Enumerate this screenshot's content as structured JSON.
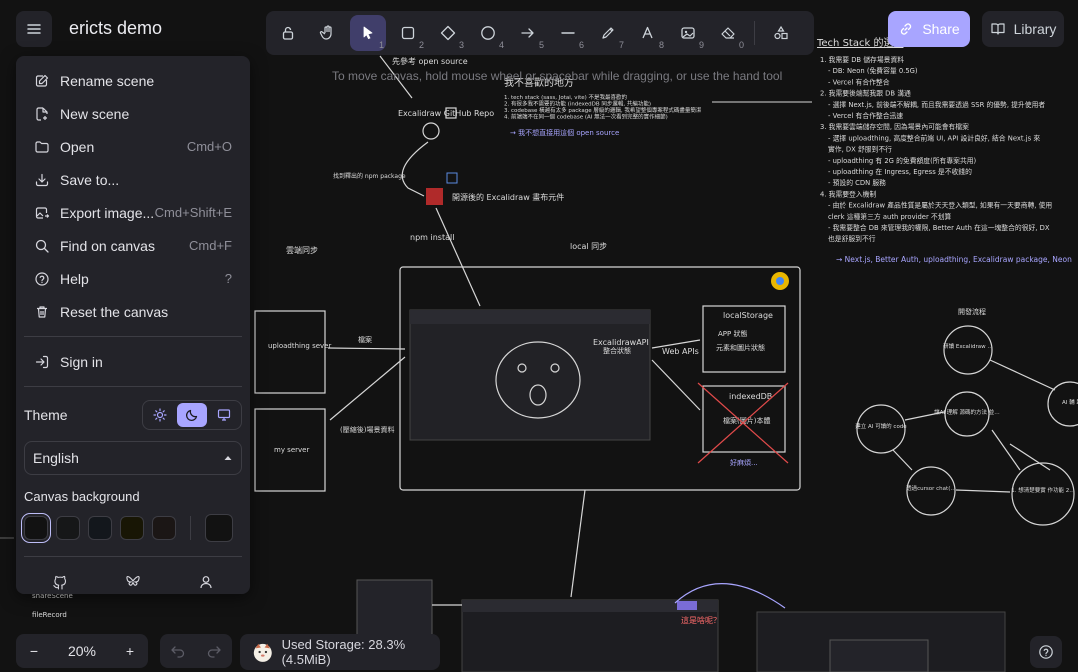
{
  "app": {
    "scene_name": "ericts demo",
    "hint": "To move canvas, hold mouse wheel or spacebar while dragging, or use the hand tool"
  },
  "toolbar": {
    "tools": [
      {
        "icon": "lock-icon",
        "key": ""
      },
      {
        "icon": "hand-icon",
        "key": ""
      },
      {
        "icon": "pointer-icon",
        "key": "1"
      },
      {
        "icon": "rectangle-icon",
        "key": "2"
      },
      {
        "icon": "diamond-icon",
        "key": "3"
      },
      {
        "icon": "ellipse-icon",
        "key": "4"
      },
      {
        "icon": "arrow-icon",
        "key": "5"
      },
      {
        "icon": "line-icon",
        "key": "6"
      },
      {
        "icon": "pencil-icon",
        "key": "7"
      },
      {
        "icon": "text-icon",
        "key": "8"
      },
      {
        "icon": "image-icon",
        "key": "9"
      },
      {
        "icon": "eraser-icon",
        "key": "0"
      },
      {
        "icon": "shapes-icon",
        "key": ""
      }
    ],
    "active_tool": "pointer-icon"
  },
  "share_label": "Share",
  "library_label": "Library",
  "menu": {
    "group1": [
      {
        "label": "Rename scene",
        "shortcut": ""
      },
      {
        "label": "New scene",
        "shortcut": ""
      },
      {
        "label": "Open",
        "shortcut": "Cmd+O"
      },
      {
        "label": "Save to...",
        "shortcut": ""
      },
      {
        "label": "Export image...",
        "shortcut": "Cmd+Shift+E"
      },
      {
        "label": "Find on canvas",
        "shortcut": "Cmd+F"
      },
      {
        "label": "Help",
        "shortcut": "?"
      },
      {
        "label": "Reset the canvas",
        "shortcut": ""
      }
    ],
    "sign_in": "Sign in",
    "theme_label": "Theme",
    "theme_selected": "dark",
    "language": "English",
    "canvas_bg_label": "Canvas background",
    "swatches": [
      "#121212",
      "#161718",
      "#13171c",
      "#181605",
      "#1b1615"
    ],
    "custom_swatch": "#121212"
  },
  "zoom": {
    "minus": "−",
    "value": "20%",
    "plus": "+"
  },
  "storage": "Used Storage: 28.3% (4.5MiB)",
  "canvas": {
    "ref_open_source": "先參考 open source",
    "excalidraw_repo": "Excalidraw GitHub Repo",
    "find_npm": "找到釋出的 npm package",
    "npm_pkg": "開源後的 Excalidraw 畫布元件",
    "npm_install": "npm install",
    "local_sync": "local 同步",
    "cloud_sync": "雲端同步",
    "not_like_title": "我不喜歡的地方",
    "not_like_items": [
      "1. tech stack (sass, Jotai, vite) 不是我最喜歡的",
      "2. 有很多我不需要的功能 (indexedDB 同步邏輯, 共編功能)",
      "3. codebase 橫越有太多 package 層級的邏輯, 我希望整個專案程式碼盡量簡潔",
      "4. 前端端不在同一個 codebase (AI 無法一次看到完整的實作細節)"
    ],
    "not_use_os": "→ 我不想直接用這個 open source",
    "tech_stack_title": "Tech Stack 的選擇",
    "tech_stack_items": [
      "1. 我需要 DB 儲存場景資料",
      "- DB: Neon (免費容量 0.5G)",
      "- Vercel 有合作整合",
      "2. 我需要後端幫我跟 DB 溝通",
      "- 選擇 Next.js, 前後端不解耦, 而且我需要透過 SSR 的優勢, 提升使用者",
      "- Vercel 有合作整合迅速",
      "3. 我需要雲端儲存空間, 因為場景內可能會有檔案",
      "- 選擇 uploadthing, 高度整合前端 UI, API 設計良好, 結合 Next.js 來",
      "  實作, DX 舒服到不行",
      "- uploadthing 有 2G 的免費額度(所有專案共用)",
      "- uploadthing 在 Ingress, Egress 是不收錢的",
      "- 預設的 CDN 服務",
      "4. 我需要登入機制",
      "- 由於 Excalidraw 產品性質是屬於天天登入類型, 如果有一天要商轉, 使用",
      "  clerk 這種第三方 auth provider 不划算",
      "- 我需要整合 DB 來管理我的權限, Better Auth 在這一塊整合的很好, DX",
      "  也是舒服到不行"
    ],
    "tech_result": "→ Next.js, Better Auth, uploadthing, Excalidraw package, Neon",
    "upload_server": "uploadthing sever",
    "file_label": "檔案",
    "my_server": "my server",
    "compressed": "(壓縮後)場景資料",
    "excal_api": "ExcalidrawAPI",
    "excal_state": "整合狀態",
    "web_apis": "Web APIs",
    "local_storage": "localStorage",
    "app_state": "APP 狀態",
    "element_state": "元素和圖片狀態",
    "indexed_db": "indexedDB",
    "file_storage": "檔案(圖片)本體",
    "slow": "好麻煩...",
    "dev_flow": "開發流程",
    "flow_nodes": [
      "研讀 Excalidraw open source codebase",
      "建立 AI 可讀的 code",
      "讓AI 理解 源碼的方法 並設計與重 構",
      "透過cursor chat(GPT-5) 實現功能 在我自己的 codebase",
      "1. 想清楚要實 作功能 2. 參照open source Preset 範例"
    ],
    "node_ai": "AI 輔 助",
    "share_scene": "shareScene",
    "file_record": "fileRecord",
    "what_is_this": "這是啥呢？"
  }
}
